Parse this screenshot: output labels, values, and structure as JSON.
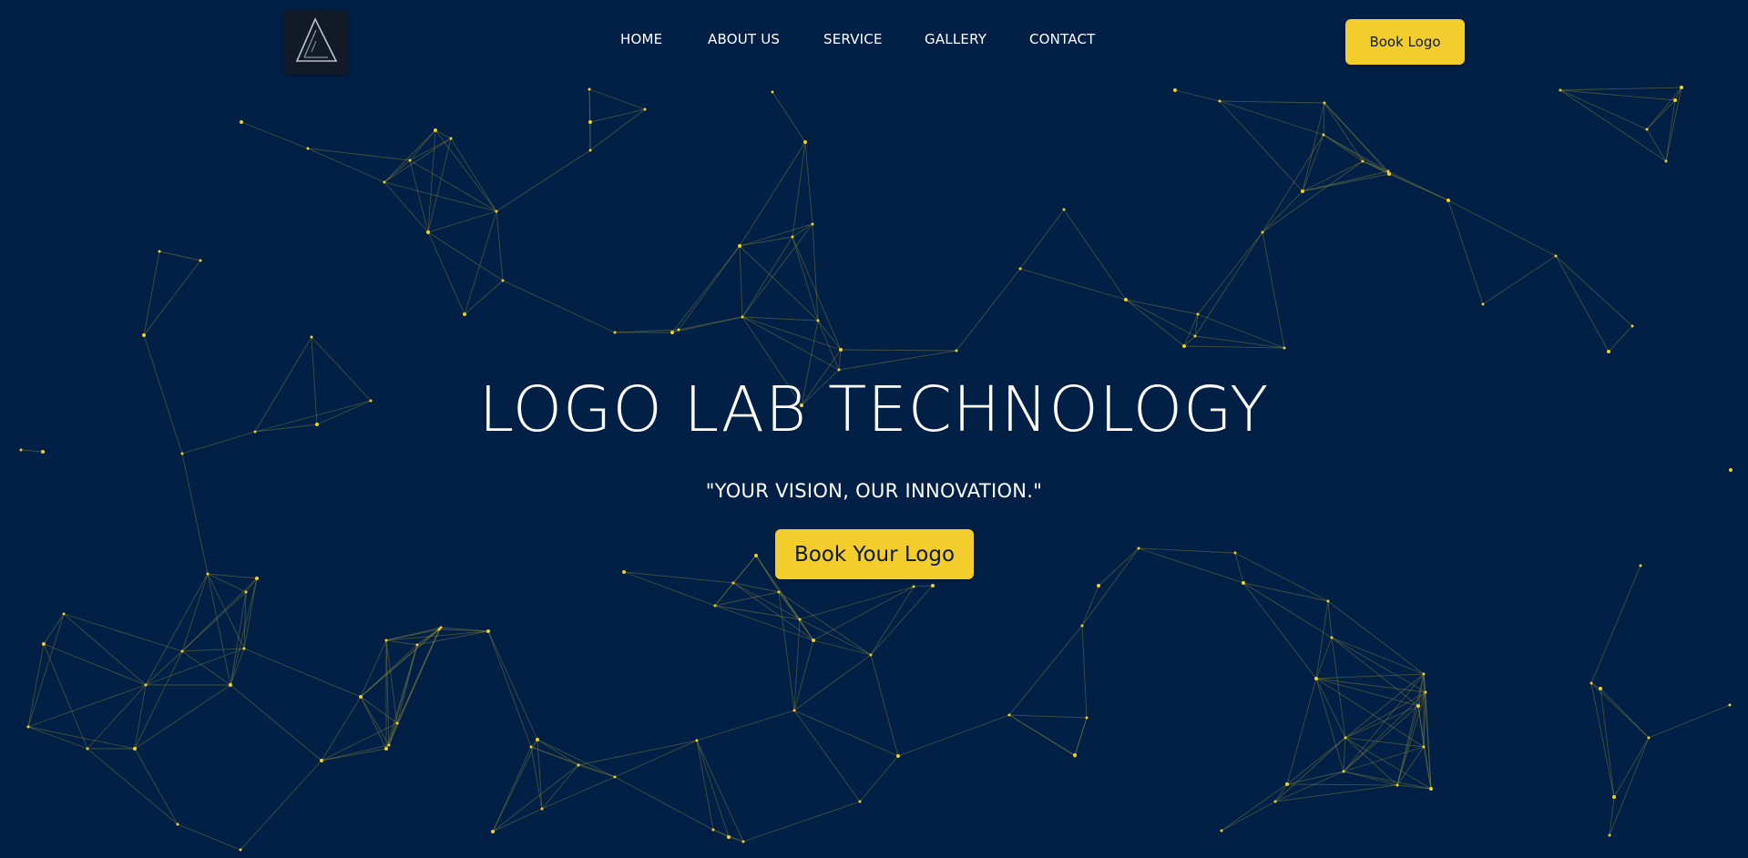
{
  "header": {
    "logo_icon": "triangle-logo-icon",
    "nav": [
      {
        "label": "HOME"
      },
      {
        "label": "ABOUT US"
      },
      {
        "label": "SERVICE"
      },
      {
        "label": "GALLERY"
      },
      {
        "label": "CONTACT"
      }
    ],
    "book_button_label": "Book Logo"
  },
  "hero": {
    "title": "LOGO LAB TECHNOLOGY",
    "subtitle": "\"YOUR VISION, OUR INNOVATION.\"",
    "cta_label": "Book Your Logo"
  },
  "colors": {
    "background": "#022045",
    "accent": "#f2cd2b",
    "text": "#ffffff",
    "network_node": "#f4d020"
  }
}
